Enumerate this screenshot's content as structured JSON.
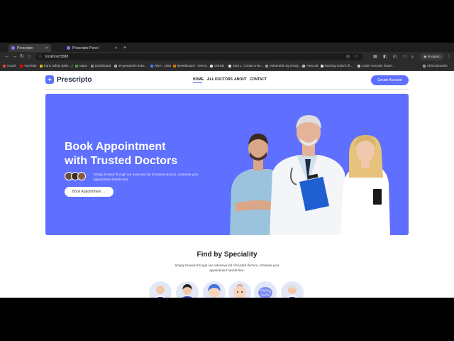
{
  "tabs": [
    {
      "label": "Prescripto",
      "active": true
    },
    {
      "label": "Prescripto Panel",
      "active": false
    }
  ],
  "new_tab_label": "+",
  "address": {
    "url": "localhost:5888"
  },
  "incognito_label": "Incognito",
  "bookmarks": [
    {
      "label": "Gmail",
      "color": "#ea4335"
    },
    {
      "label": "YouTube",
      "color": "#ff0000"
    },
    {
      "label": "trans safety (take…)",
      "color": "#f4b400"
    },
    {
      "label": "Maps",
      "color": "#34a853"
    },
    {
      "label": "Dashboard",
      "color": "#888888"
    },
    {
      "label": "dr-greatest/n-subs…",
      "color": "#aaaaaa"
    },
    {
      "label": "RNA - 1052",
      "color": "#4285f4"
    },
    {
      "label": "BreedGuard - Overvi…",
      "color": "#e37400"
    },
    {
      "label": "GitHub",
      "color": "#dddddd"
    },
    {
      "label": "Step 1: Create a Re…",
      "color": "#dddddd"
    },
    {
      "label": "Vulnerable By Desig…",
      "color": "#999999"
    },
    {
      "label": "Pancold",
      "color": "#bbbbbb"
    },
    {
      "label": "hacking tools/AI fl…",
      "color": "#dddddd"
    },
    {
      "label": "Cyber Security Road…",
      "color": "#cccccc"
    }
  ],
  "all_bookmarks_label": "All Bookmarks",
  "site": {
    "logo_text": "Prescripto",
    "nav": [
      "HOME",
      "ALL DOCTORS",
      "ABOUT",
      "CONTACT"
    ],
    "create_account": "Create Account",
    "accent": "#5f6fff",
    "hero": {
      "title_line1": "Book Appointment",
      "title_line2": "with Trusted Doctors",
      "description": "Simply browse through our extensive list of trusted doctors, schedule your appointment hassle-free.",
      "button": "Book Appointment →"
    },
    "speciality": {
      "title": "Find by Speciality",
      "description": "Simply browse through our extensive list of trusted doctors, schedule your appointment hassle-free.",
      "icons": [
        "general-physician-icon",
        "gynecologist-icon",
        "dermatologist-icon",
        "pediatrician-icon",
        "neurologist-icon",
        "gastroenterologist-icon"
      ]
    }
  }
}
